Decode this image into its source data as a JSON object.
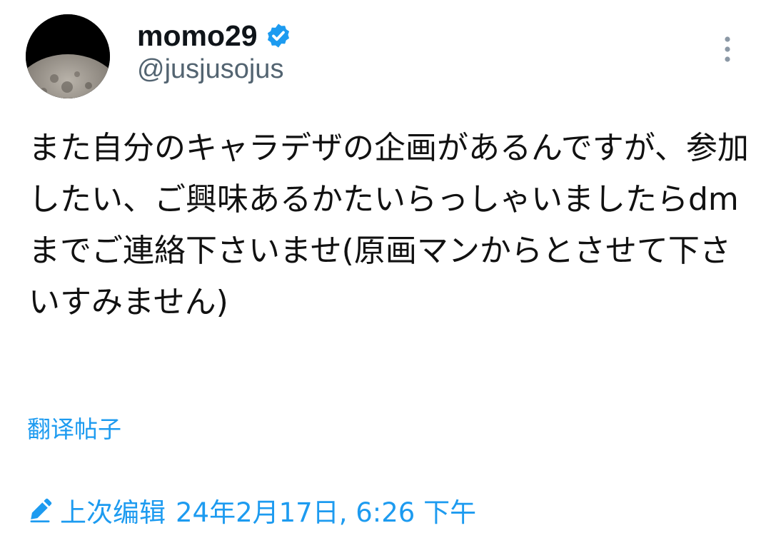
{
  "author": {
    "name": "momo29",
    "handle": "@jusjusojus",
    "verified": true
  },
  "tweet": {
    "text": "また自分のキャラデザの企画があるんですが、参加したい、ご興味あるかたいらっしゃいましたらdmまでご連絡下さいませ(原画マンからとさせて下さいすみません)"
  },
  "translate_label": "翻译帖子",
  "edit": {
    "label": "上次编辑",
    "timestamp": "24年2月17日, 6:26 下午"
  },
  "icons": {
    "verified": "verified-badge-icon",
    "more": "more-vertical-icon",
    "edit": "pencil-icon"
  },
  "colors": {
    "accent": "#1d9bf0",
    "text": "#0f1419",
    "secondary": "#536471"
  }
}
